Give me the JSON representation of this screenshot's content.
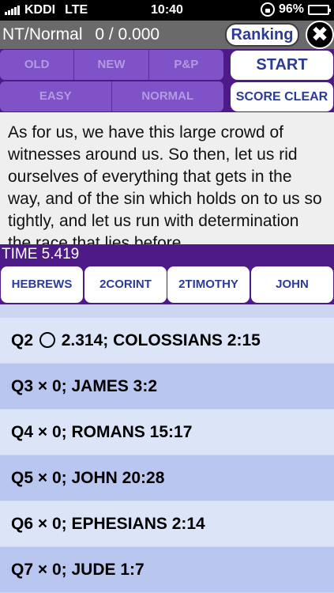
{
  "status": {
    "carrier": "KDDI",
    "network": "LTE",
    "time": "10:40",
    "battery_text": "96%",
    "battery_level": 0.96
  },
  "header": {
    "mode_label": "NT/Normal",
    "score_label": "0 / 0.000",
    "ranking_label": "Ranking",
    "close_icon": "✖"
  },
  "controls": {
    "testament_tabs": [
      "OLD",
      "NEW",
      "P&P"
    ],
    "difficulty_tabs": [
      "EASY",
      "NORMAL"
    ],
    "start_label": "START",
    "score_clear_label": "SCORE CLEAR"
  },
  "verse": {
    "text": "As for us, we have this large crowd of witnesses around us. So then, let us rid ourselves of everything that gets in the way, and of the sin which holds on to us so tightly, and let us run with determination the race that lies before"
  },
  "timer": {
    "label": "TIME 5.419"
  },
  "choices": [
    "HEBREWS",
    "2CORINT",
    "2TIMOTHY",
    "JOHN"
  ],
  "results": [
    {
      "q": "Q2",
      "mark": "circle",
      "value": "2.314;",
      "ref": "COLOSSIANS 2:15"
    },
    {
      "q": "Q3",
      "mark": "×",
      "value": "0;",
      "ref": "JAMES 3:2"
    },
    {
      "q": "Q4",
      "mark": "×",
      "value": "0;",
      "ref": "ROMANS 15:17"
    },
    {
      "q": "Q5",
      "mark": "×",
      "value": "0;",
      "ref": "JOHN 20:28"
    },
    {
      "q": "Q6",
      "mark": "×",
      "value": "0;",
      "ref": "EPHESIANS 2:14"
    },
    {
      "q": "Q7",
      "mark": "×",
      "value": "0;",
      "ref": "JUDE 1:7"
    }
  ],
  "colors": {
    "panel_purple": "#4e1a88",
    "segment_purple": "#7f52c7",
    "button_text_blue": "#2d3c93",
    "row_light": "#dce4f8",
    "row_dark": "#b9c6ef"
  }
}
